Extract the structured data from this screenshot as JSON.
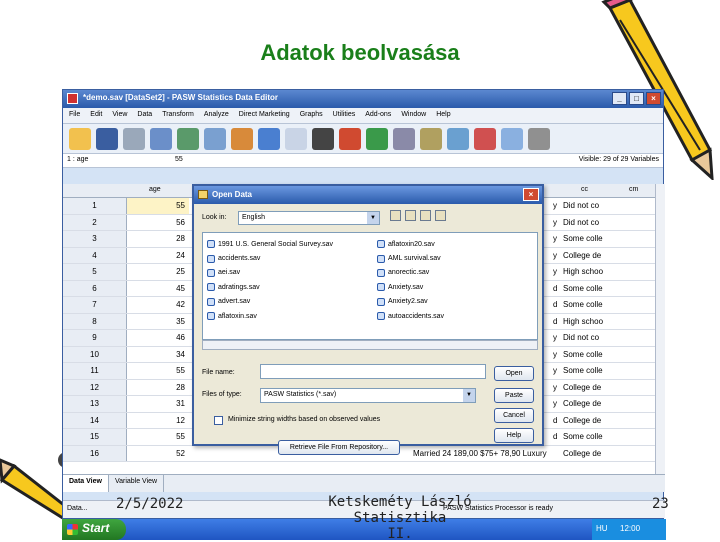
{
  "slide": {
    "title": "Adatok beolvasása",
    "footer_date": "2/5/2022",
    "footer_center_line1": "Ketskeméty László Statisztika",
    "footer_center_line2": "II.",
    "page_number": "23"
  },
  "spss": {
    "title": "*demo.sav [DataSet2] - PASW Statistics Data Editor",
    "menu": [
      "File",
      "Edit",
      "View",
      "Data",
      "Transform",
      "Analyze",
      "Direct Marketing",
      "Graphs",
      "Utilities",
      "Add-ons",
      "Window",
      "Help"
    ],
    "cell_ref": "1 : age",
    "cell_value": "55",
    "visible": "Visible: 29 of 29 Variables",
    "col_age": "age",
    "col_cc": "cc",
    "col_cm": "cm",
    "rows": [
      {
        "n": "1",
        "age": "55",
        "c3": "",
        "c1": "y",
        "c2": "Did not co"
      },
      {
        "n": "2",
        "age": "56",
        "c3": "",
        "c1": "y",
        "c2": "Did not co"
      },
      {
        "n": "3",
        "age": "28",
        "c3": "",
        "c1": "y",
        "c2": "Some colle"
      },
      {
        "n": "4",
        "age": "24",
        "c3": "",
        "c1": "y",
        "c2": "College de"
      },
      {
        "n": "5",
        "age": "25",
        "c3": "",
        "c1": "y",
        "c2": "High schoo"
      },
      {
        "n": "6",
        "age": "45",
        "c3": "",
        "c1": "d",
        "c2": "Some colle"
      },
      {
        "n": "7",
        "age": "42",
        "c3": "",
        "c1": "d",
        "c2": "Some colle"
      },
      {
        "n": "8",
        "age": "35",
        "c3": "",
        "c1": "d",
        "c2": "High schoo"
      },
      {
        "n": "9",
        "age": "46",
        "c3": "",
        "c1": "y",
        "c2": "Did not co"
      },
      {
        "n": "10",
        "age": "34",
        "c3": "",
        "c1": "y",
        "c2": "Some colle"
      },
      {
        "n": "11",
        "age": "55",
        "c3": "",
        "c1": "y",
        "c2": "Some colle"
      },
      {
        "n": "12",
        "age": "28",
        "c3": "",
        "c1": "y",
        "c2": "College de"
      },
      {
        "n": "13",
        "age": "31",
        "c3": "",
        "c1": "y",
        "c2": "College de"
      },
      {
        "n": "14",
        "age": "12",
        "c3": "",
        "c1": "d",
        "c2": "College de"
      },
      {
        "n": "15",
        "age": "55",
        "c3": "",
        "c1": "d",
        "c2": "Some colle"
      },
      {
        "n": "16",
        "age": "52",
        "c3": "Married    24    189,00    $75+    78,90  Luxury",
        "c1": "",
        "c2": "College de"
      }
    ],
    "tab_data": "Data View",
    "tab_variable": "Variable View",
    "status_left": "Data...",
    "status_right": "PASW Statistics Processor is ready"
  },
  "dialog": {
    "title": "Open Data",
    "look_in_label": "Look in:",
    "look_in_value": "English",
    "files_col1": [
      "1991 U.S. General Social Survey.sav",
      "accidents.sav",
      "aei.sav",
      "adratings.sav",
      "advert.sav",
      "aflatoxin.sav"
    ],
    "files_col2": [
      "aflatoxin20.sav",
      "AML survival.sav",
      "anorectic.sav",
      "Anxiety.sav",
      "Anxiety2.sav",
      "autoaccidents.sav"
    ],
    "file_name_label": "File name:",
    "file_name_value": "",
    "file_type_label": "Files of type:",
    "file_type_value": "PASW Statistics (*.sav)",
    "minimize_label": "Minimize string widths based on observed values",
    "btn_open": "Open",
    "btn_paste": "Paste",
    "btn_cancel": "Cancel",
    "btn_help": "Help",
    "btn_retrieve": "Retrieve File From Repository..."
  },
  "taskbar": {
    "start": "Start",
    "lang": "HU",
    "clock": "12:00"
  }
}
